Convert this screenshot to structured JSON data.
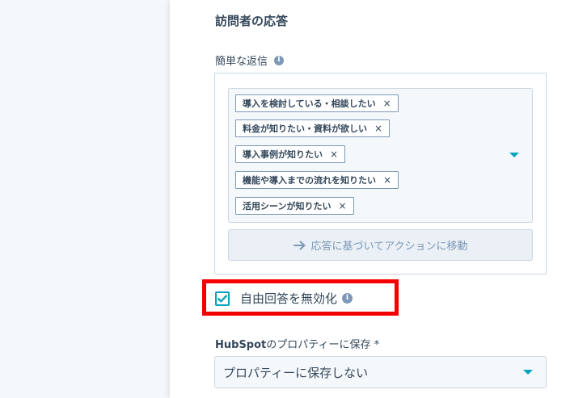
{
  "section": {
    "title": "訪問者の応答"
  },
  "quick_replies": {
    "label": "簡単な返信",
    "info_icon": "info-icon",
    "tags": [
      {
        "label": "導入を検討している・相談したい",
        "remove": "×"
      },
      {
        "label": "料金が知りたい・資料が欲しい",
        "remove": "×"
      },
      {
        "label": "導入事例が知りたい",
        "remove": "×"
      },
      {
        "label": "機能や導入までの流れを知りたい",
        "remove": "×"
      },
      {
        "label": "活用シーンが知りたい",
        "remove": "×"
      }
    ],
    "action_button": {
      "icon": "arrow-right-icon",
      "label": "応答に基づいてアクションに移動"
    }
  },
  "free_text": {
    "label": "自由回答を無効化",
    "checked": true
  },
  "property": {
    "label_brand": "HubSpot",
    "label_rest": "のプロパティーに保存 *",
    "selected": "プロパティーに保存しない"
  },
  "colors": {
    "accent": "#00a4bd",
    "highlight": "#f50000",
    "text": "#33475b",
    "muted": "#7c98b6"
  }
}
